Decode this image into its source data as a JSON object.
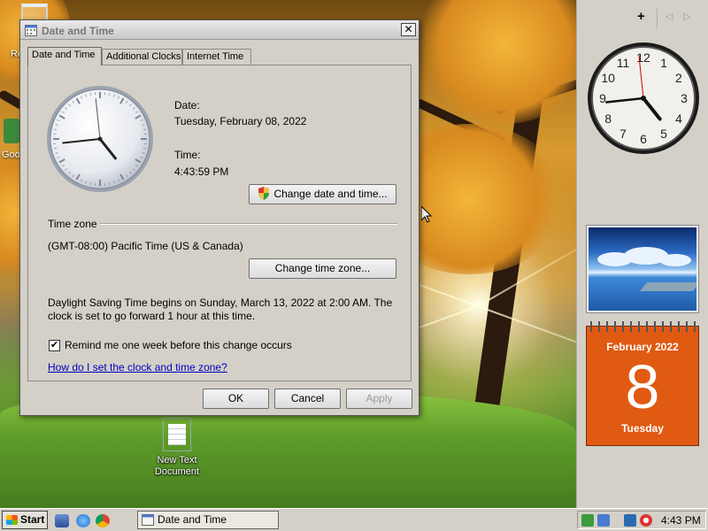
{
  "dialog": {
    "title": "Date and Time",
    "close_glyph": "✕",
    "tabs": [
      {
        "label": "Date and Time",
        "active": true
      },
      {
        "label": "Additional Clocks",
        "active": false
      },
      {
        "label": "Internet Time",
        "active": false
      }
    ],
    "date_label": "Date:",
    "date_value": "Tuesday, February 08, 2022",
    "time_label": "Time:",
    "time_value": "4:43:59 PM",
    "change_datetime_button": "Change date and time...",
    "timezone_header": "Time zone",
    "timezone_value": "(GMT-08:00) Pacific Time (US & Canada)",
    "change_timezone_button": "Change time zone...",
    "dst_line1": "Daylight Saving Time begins on Sunday, March 13, 2022 at 2:00 AM. The",
    "dst_line2": "clock is set to go forward 1 hour at this time.",
    "remind_checkbox_label": "Remind me one week before this change occurs",
    "remind_checked": true,
    "remind_check_glyph": "✔",
    "help_link": "How do I set the clock and time zone?",
    "ok_button": "OK",
    "cancel_button": "Cancel",
    "apply_button": "Apply",
    "clock": {
      "hour": 4,
      "minute": 43,
      "second": 59
    }
  },
  "desktop": {
    "icons": [
      {
        "label_line1": "New Text",
        "label_line2": "Document"
      }
    ],
    "edge_labels": [
      "Re",
      "Goo"
    ]
  },
  "sidebar": {
    "add_glyph": "+",
    "prev_glyph": "◁",
    "next_glyph": "▷",
    "clock": {
      "hour": 4,
      "minute": 43,
      "second": 59
    },
    "calendar": {
      "month": "February 2022",
      "day": "8",
      "weekday": "Tuesday"
    }
  },
  "taskbar": {
    "start_label": "Start",
    "task_label": "Date and Time",
    "tray_time": "4:43 PM"
  },
  "colors": {
    "calendar_orange": "#e05a12",
    "link_blue": "#0000c0",
    "dialog_gray": "#d4d0c8"
  }
}
